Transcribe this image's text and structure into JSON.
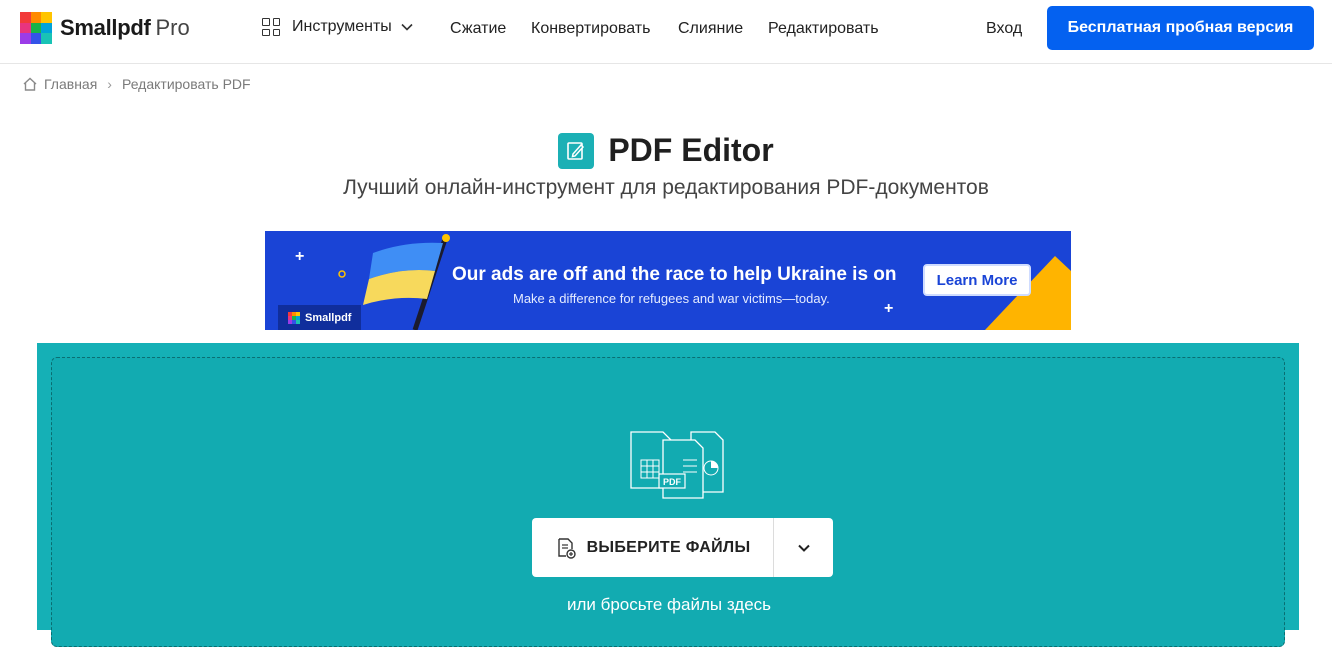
{
  "header": {
    "logo_text": "Smallpdf",
    "logo_suffix": "Pro",
    "tools_label": "Инструменты",
    "nav": [
      "Сжатие",
      "Конвертировать",
      "Слияние",
      "Редактировать"
    ],
    "login_label": "Вход",
    "trial_label": "Бесплатная пробная версия"
  },
  "breadcrumb": {
    "home": "Главная",
    "current": "Редактировать PDF"
  },
  "page": {
    "title": "PDF Editor",
    "subtitle": "Лучший онлайн-инструмент для редактирования PDF-документов"
  },
  "banner": {
    "headline": "Our ads are off and the race to help Ukraine is on",
    "subline": "Make a difference for refugees and war victims—today.",
    "cta": "Learn More",
    "badge": "Smallpdf"
  },
  "dropzone": {
    "choose_label": "ВЫБЕРИТЕ ФАЙЛЫ",
    "hint": "или бросьте файлы здесь",
    "illustration_label": "PDF"
  },
  "colors": {
    "brand_blue": "#0461f0",
    "tool_teal": "#15b0b6",
    "banner_blue": "#1a44d6"
  }
}
